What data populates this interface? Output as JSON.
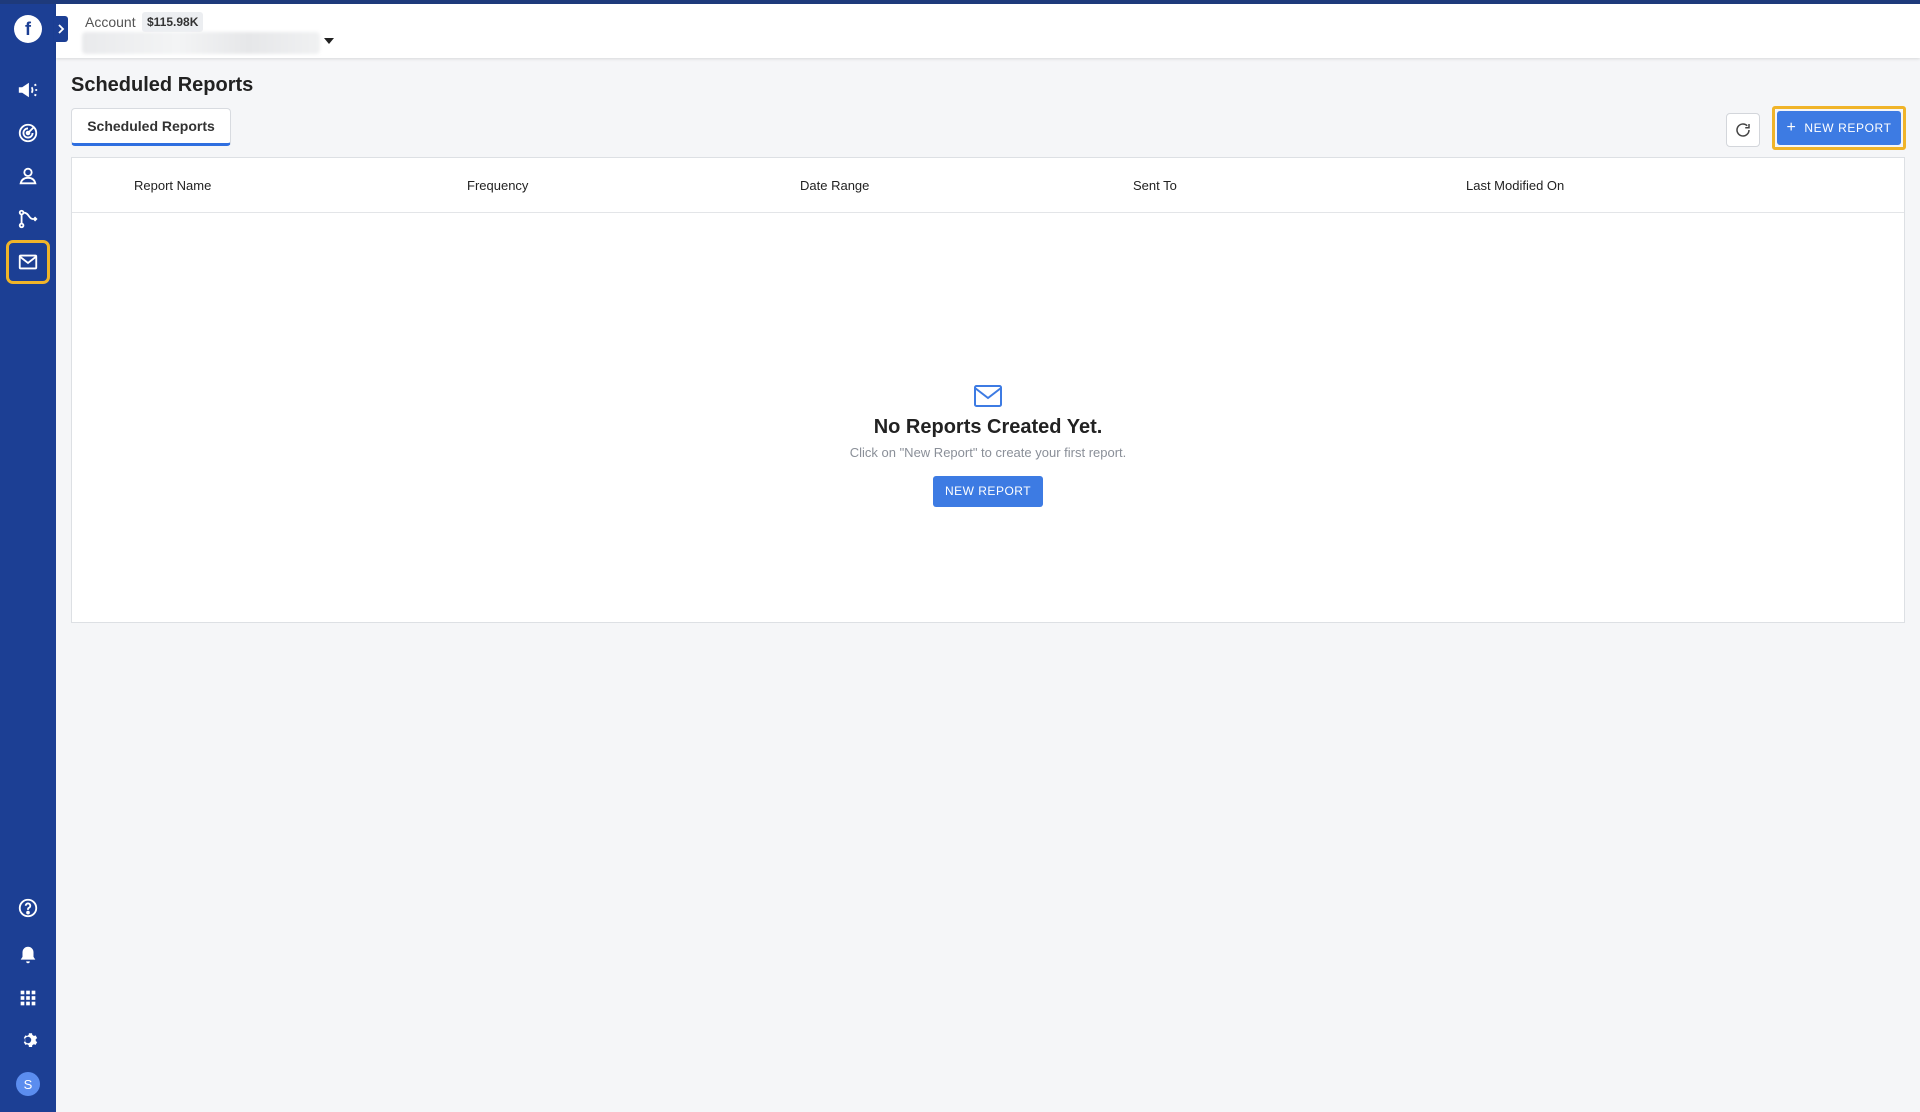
{
  "brand": {
    "logo_letter": "f",
    "accent": "#1c3f94",
    "primary_button": "#3d7be3",
    "highlight": "#f0b429"
  },
  "sidebar": {
    "items": [
      {
        "icon": "megaphone-icon"
      },
      {
        "icon": "radar-icon"
      },
      {
        "icon": "user-icon"
      },
      {
        "icon": "pipeline-icon"
      },
      {
        "icon": "mail-icon",
        "active": true
      }
    ],
    "bottom": [
      {
        "icon": "help-icon"
      },
      {
        "icon": "bell-icon"
      },
      {
        "icon": "apps-grid-icon"
      },
      {
        "icon": "gear-icon"
      }
    ],
    "avatar_initial": "S"
  },
  "header": {
    "account_label": "Account",
    "account_balance": "$115.98K"
  },
  "page": {
    "title": "Scheduled Reports",
    "tabs": [
      {
        "label": "Scheduled Reports",
        "active": true
      }
    ],
    "new_report_label": "NEW REPORT"
  },
  "table": {
    "columns": [
      "Report Name",
      "Frequency",
      "Date Range",
      "Sent To",
      "Last Modified On"
    ]
  },
  "empty_state": {
    "title": "No Reports Created Yet.",
    "subtitle": "Click on \"New Report\" to create your first report.",
    "button_label": "NEW REPORT"
  }
}
